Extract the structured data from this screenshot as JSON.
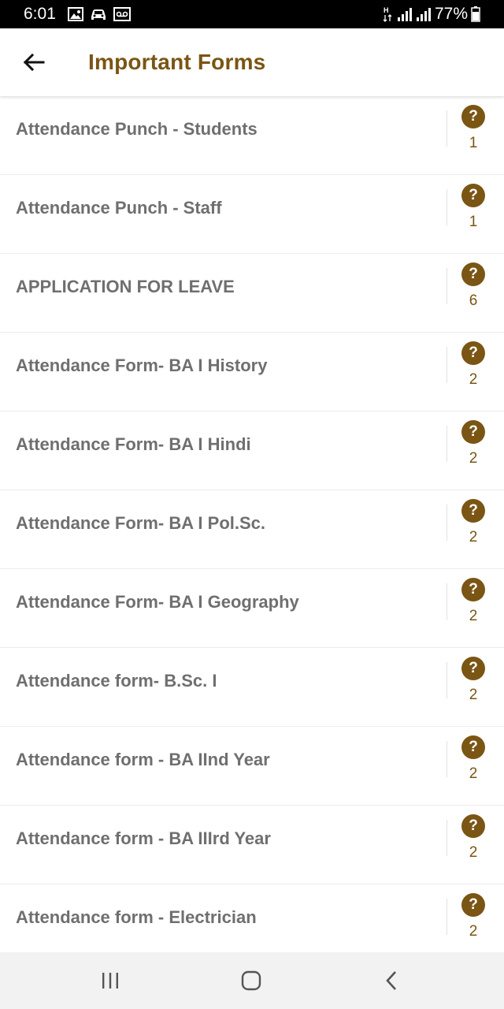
{
  "status_bar": {
    "time": "6:01",
    "battery": "77%",
    "network_label": "H",
    "icons_left": [
      "gallery-icon",
      "car-icon",
      "voicemail-icon"
    ],
    "icons_right": [
      "data-arrows-icon",
      "signal-icon",
      "signal-icon",
      "battery-icon"
    ]
  },
  "header": {
    "back_icon": "arrow-left-icon",
    "title": "Important Forms"
  },
  "colors": {
    "accent": "#7a5514",
    "item_text": "#6f6f6f",
    "status_bar_bg": "#000000",
    "nav_bar_bg": "#f2f2f2"
  },
  "forms": [
    {
      "title": "Attendance Punch - Students",
      "help_icon": "?",
      "count": "1"
    },
    {
      "title": "Attendance Punch - Staff",
      "help_icon": "?",
      "count": "1"
    },
    {
      "title": "APPLICATION FOR LEAVE",
      "help_icon": "?",
      "count": "6"
    },
    {
      "title": "Attendance Form- BA I History",
      "help_icon": "?",
      "count": "2"
    },
    {
      "title": "Attendance Form- BA I Hindi",
      "help_icon": "?",
      "count": "2"
    },
    {
      "title": "Attendance Form- BA I Pol.Sc.",
      "help_icon": "?",
      "count": "2"
    },
    {
      "title": "Attendance Form- BA I Geography",
      "help_icon": "?",
      "count": "2"
    },
    {
      "title": "Attendance form- B.Sc. I",
      "help_icon": "?",
      "count": "2"
    },
    {
      "title": "Attendance form - BA IInd Year",
      "help_icon": "?",
      "count": "2"
    },
    {
      "title": "Attendance form - BA IIIrd Year",
      "help_icon": "?",
      "count": "2"
    },
    {
      "title": "Attendance form - Electrician",
      "help_icon": "?",
      "count": "2"
    }
  ],
  "nav_bar": {
    "recents_icon": "recent-apps-icon",
    "home_icon": "home-icon",
    "back_icon": "back-chevron-icon"
  }
}
